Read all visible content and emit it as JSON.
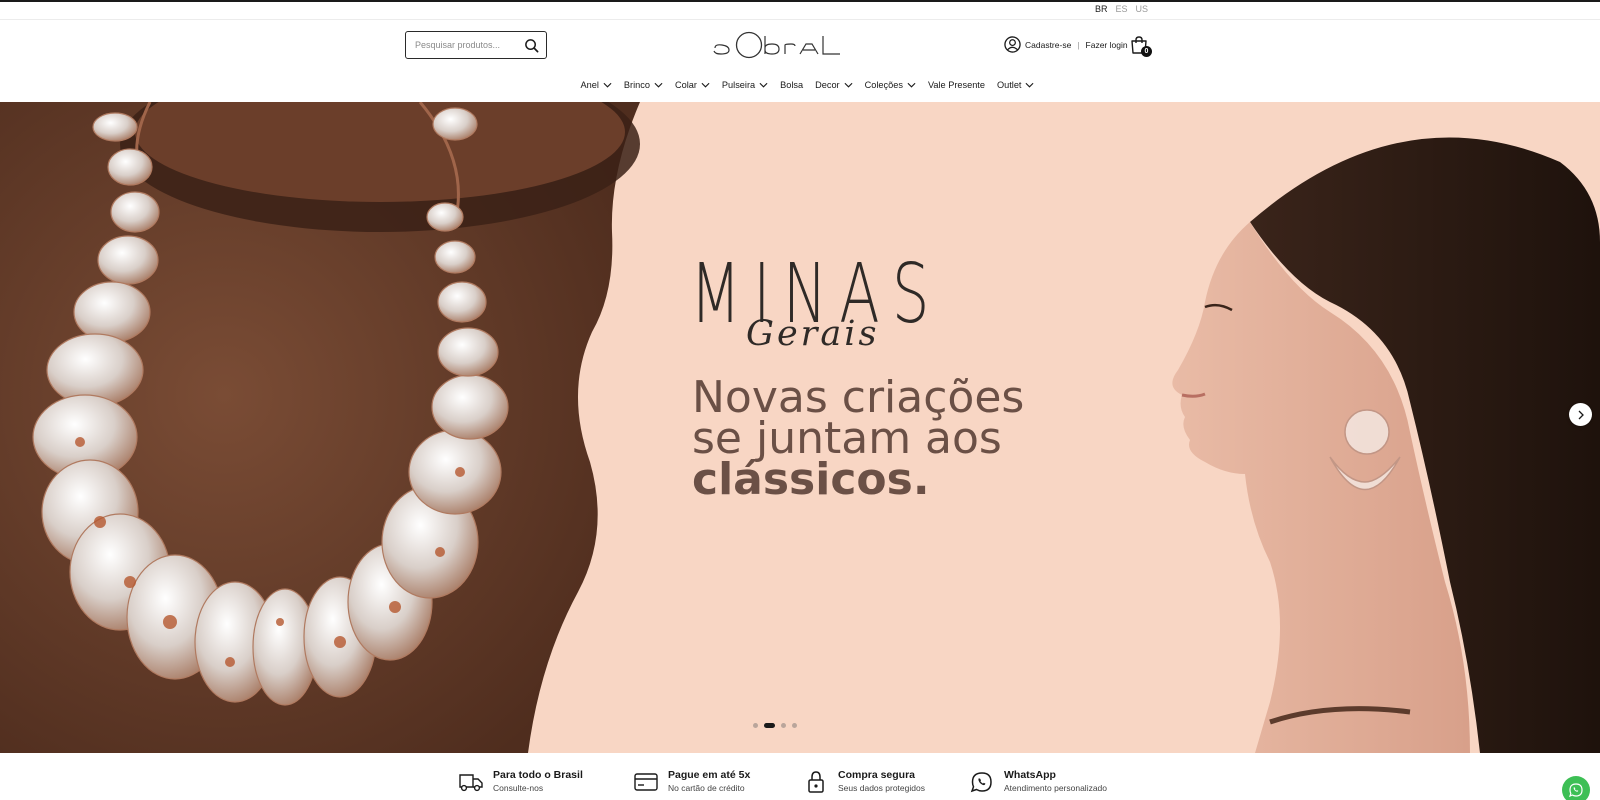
{
  "languages": [
    {
      "code": "BR",
      "active": true
    },
    {
      "code": "ES",
      "active": false
    },
    {
      "code": "US",
      "active": false
    }
  ],
  "search": {
    "placeholder": "Pesquisar produtos...",
    "icon": "search-icon"
  },
  "logo": {
    "text": "sobral"
  },
  "account": {
    "signup_label": "Cadastre-se",
    "separator": "|",
    "login_label": "Fazer login",
    "icon": "user-circle-icon"
  },
  "cart": {
    "count": "0",
    "icon": "shopping-bag-icon"
  },
  "nav": {
    "items": [
      {
        "label": "Anel",
        "dropdown": true
      },
      {
        "label": "Brinco",
        "dropdown": true
      },
      {
        "label": "Colar",
        "dropdown": true
      },
      {
        "label": "Pulseira",
        "dropdown": true
      },
      {
        "label": "Bolsa",
        "dropdown": false
      },
      {
        "label": "Decor",
        "dropdown": true
      },
      {
        "label": "Coleções",
        "dropdown": true
      },
      {
        "label": "Vale Presente",
        "dropdown": false
      },
      {
        "label": "Outlet",
        "dropdown": true
      }
    ]
  },
  "hero": {
    "title": "MINAS",
    "script": "Gerais",
    "line1": "Novas criações",
    "line2": "se juntam aos",
    "line3": "clássicos.",
    "active_slide": 2,
    "slide_count": 4,
    "colors": {
      "peach": "#f7d4c2",
      "brown": "#6b4532",
      "text": "#6b5046"
    }
  },
  "features": [
    {
      "icon": "truck-icon",
      "title": "Para todo o Brasil",
      "subtitle": "Consulte-nos"
    },
    {
      "icon": "credit-card-icon",
      "title": "Pague em até 5x",
      "subtitle": "No cartão de crédito"
    },
    {
      "icon": "lock-icon",
      "title": "Compra segura",
      "subtitle": "Seus dados protegidos"
    },
    {
      "icon": "whatsapp-icon",
      "title": "WhatsApp",
      "subtitle": "Atendimento personalizado"
    }
  ],
  "whatsapp_float": {
    "icon": "whatsapp-icon",
    "color": "#3dbf55"
  }
}
